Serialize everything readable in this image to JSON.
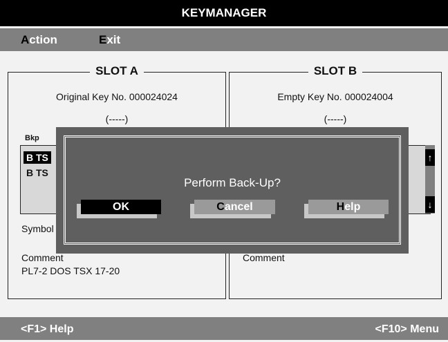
{
  "app": {
    "title": "KEYMANAGER"
  },
  "menu": {
    "action": {
      "hotkey": "A",
      "rest": "ction"
    },
    "exit": {
      "hotkey": "E",
      "rest": "xit"
    }
  },
  "slot_a": {
    "title": "SLOT A",
    "key_info": "Original Key No. 000024024",
    "key_state": "(-----)",
    "list_label": "Bkp",
    "list_items": [
      "B TS",
      "B TS"
    ],
    "symbol_label": "Symbol",
    "comment_label": "Comment",
    "comment_value": "PL7-2 DOS TSX 17-20"
  },
  "slot_b": {
    "title": "SLOT B",
    "key_info": "Empty Key No. 000024004",
    "key_state": "(-----)",
    "comment_label": "Comment"
  },
  "dialog": {
    "message": "Perform Back-Up?",
    "ok_label": "OK",
    "cancel": {
      "hotkey": "C",
      "rest": "ancel"
    },
    "help": {
      "hotkey": "H",
      "rest": "elp"
    }
  },
  "status": {
    "help": "<F1> Help",
    "menu": "<F10> Menu"
  },
  "icons": {
    "scroll_up": "arrow-up-icon",
    "scroll_down": "arrow-down-icon"
  },
  "colors": {
    "title_bg": "#000000",
    "bar_bg": "#808080",
    "dialog_bg": "#5f5f5f",
    "hotkey": "#000000"
  }
}
